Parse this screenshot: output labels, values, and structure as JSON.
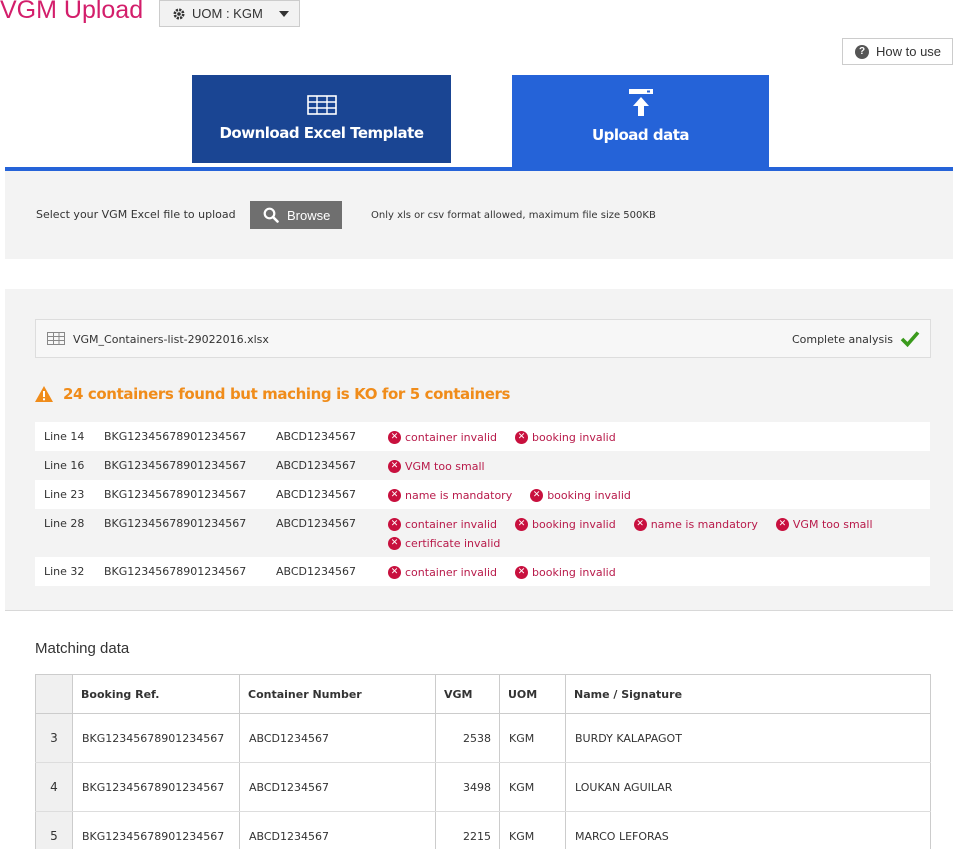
{
  "header": {
    "title": "VGM Upload",
    "uom_label": "UOM : KGM",
    "how_to_use": "How to use"
  },
  "tabs": [
    {
      "label": "Download Excel Template",
      "icon": "table-icon",
      "active": false
    },
    {
      "label": "Upload data",
      "icon": "upload-icon",
      "active": true
    }
  ],
  "upload": {
    "select_label": "Select your VGM Excel file to upload",
    "browse_label": "Browse",
    "note": "Only xls or csv format allowed, maximum file size 500KB"
  },
  "analysis": {
    "file_name": "VGM_Containers-list-29022016.xlsx",
    "status": "Complete analysis",
    "warning": "24 containers found but maching is KO for 5 containers",
    "rows": [
      {
        "line": "Line 14",
        "booking": "BKG12345678901234567",
        "container": "ABCD1234567",
        "errors": [
          "container invalid",
          "booking invalid"
        ]
      },
      {
        "line": "Line 16",
        "booking": "BKG12345678901234567",
        "container": "ABCD1234567",
        "errors": [
          "VGM too small"
        ]
      },
      {
        "line": "Line 23",
        "booking": "BKG12345678901234567",
        "container": "ABCD1234567",
        "errors": [
          "name is mandatory",
          "booking invalid"
        ]
      },
      {
        "line": "Line 28",
        "booking": "BKG12345678901234567",
        "container": "ABCD1234567",
        "errors": [
          "container invalid",
          "booking invalid",
          "name is mandatory",
          "VGM too small",
          "certificate invalid"
        ]
      },
      {
        "line": "Line 32",
        "booking": "BKG12345678901234567",
        "container": "ABCD1234567",
        "errors": [
          "container invalid",
          "booking invalid"
        ]
      }
    ]
  },
  "matching": {
    "title": "Matching data",
    "columns": [
      "Booking Ref.",
      "Container Number",
      "VGM",
      "UOM",
      "Name / Signature"
    ],
    "rows": [
      {
        "n": "3",
        "booking": "BKG12345678901234567",
        "container": "ABCD1234567",
        "vgm": "2538",
        "uom": "KGM",
        "name": "BURDY KALAPAGOT"
      },
      {
        "n": "4",
        "booking": "BKG12345678901234567",
        "container": "ABCD1234567",
        "vgm": "3498",
        "uom": "KGM",
        "name": "LOUKAN AGUILAR"
      },
      {
        "n": "5",
        "booking": "BKG12345678901234567",
        "container": "ABCD1234567",
        "vgm": "2215",
        "uom": "KGM",
        "name": "MARCO LEFORAS"
      }
    ]
  },
  "colors": {
    "title": "#d31e6b",
    "tab_download": "#1a4593",
    "tab_upload": "#2563d8",
    "warning": "#f08c1a",
    "error": "#c8103e",
    "success": "#3a9a1c"
  }
}
